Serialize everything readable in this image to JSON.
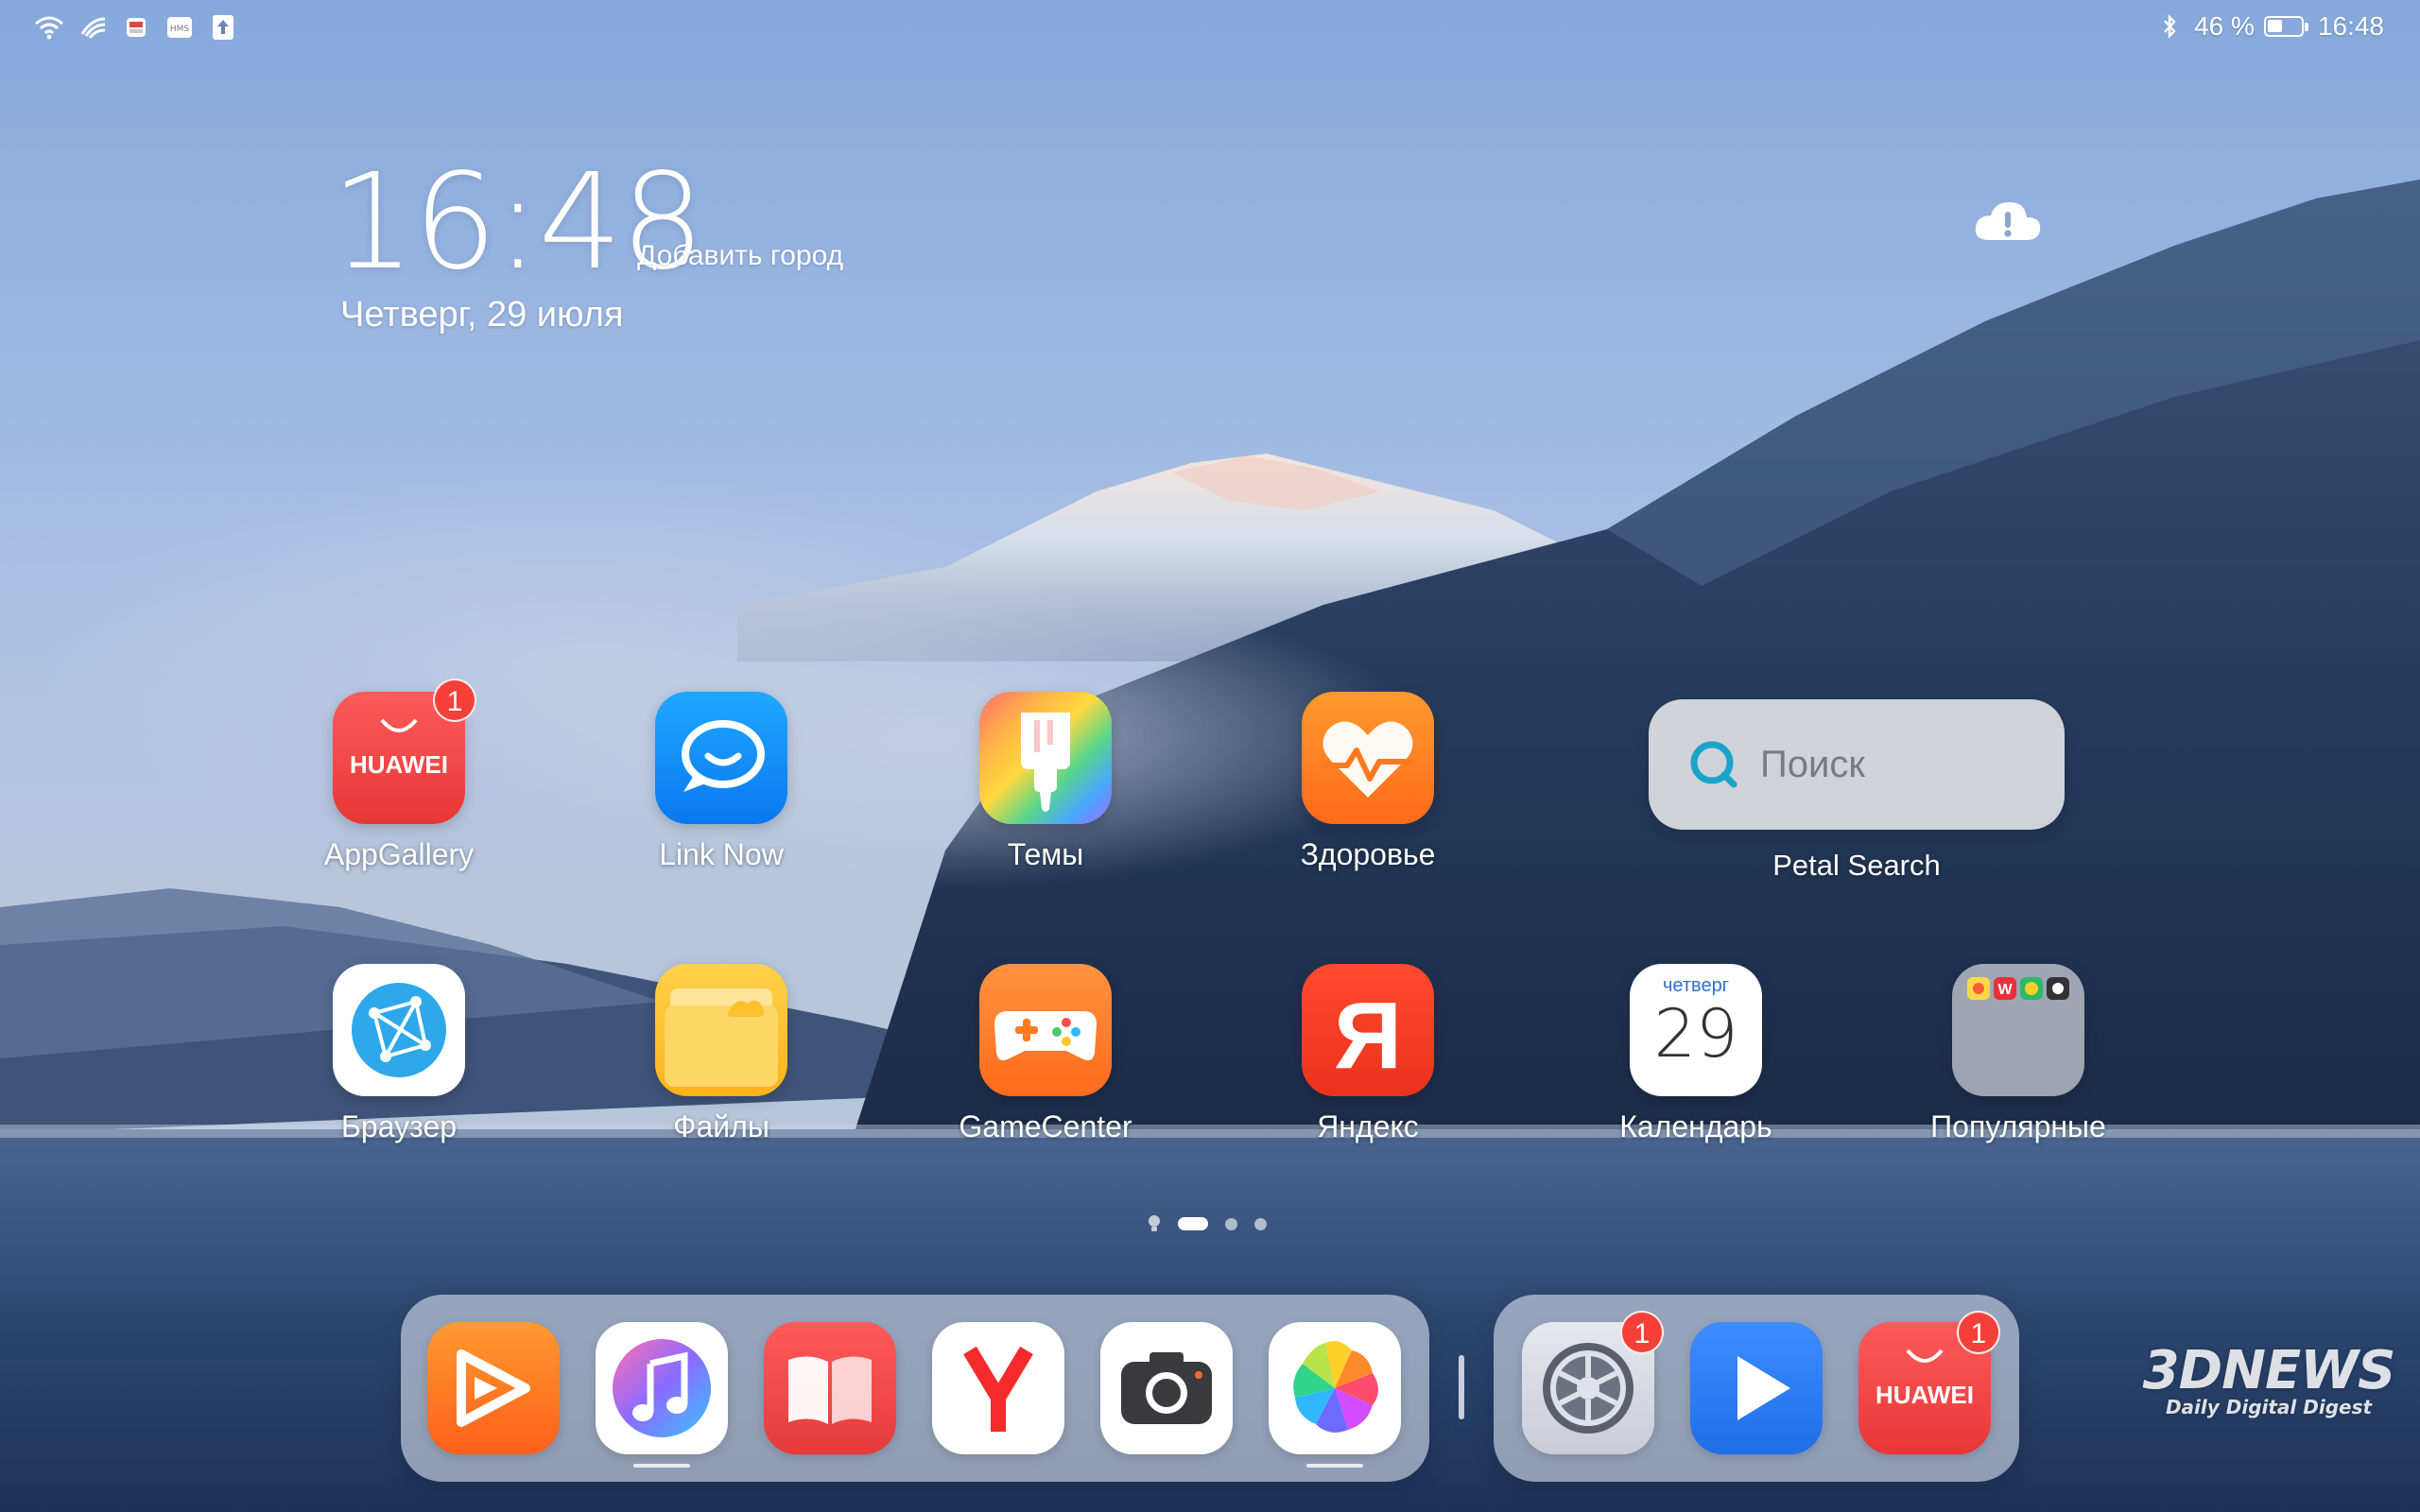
{
  "status_bar": {
    "left_icons": [
      "wifi-icon",
      "signal-icon",
      "notification-app-icon",
      "hms-icon",
      "upload-icon"
    ],
    "hms_label": "HMS",
    "bluetooth_icon": "bluetooth-icon",
    "battery_percent": "46 %",
    "battery_level": 0.46,
    "time": "16:48"
  },
  "clock_widget": {
    "time": "16:48",
    "add_city": "Добавить город",
    "date": "Четверг, 29 июля",
    "weather_icon": "cloud-alert-icon"
  },
  "apps": {
    "row1": [
      {
        "name": "appgallery",
        "label": "AppGallery",
        "badge": "1",
        "logo_text": "HUAWEI"
      },
      {
        "name": "link-now",
        "label": "Link Now"
      },
      {
        "name": "themes",
        "label": "Темы"
      },
      {
        "name": "health",
        "label": "Здоровье"
      }
    ],
    "row2": [
      {
        "name": "browser",
        "label": "Браузер"
      },
      {
        "name": "files",
        "label": "Файлы"
      },
      {
        "name": "gamecenter",
        "label": "GameCenter"
      },
      {
        "name": "yandex",
        "label": "Яндекс",
        "logo_text": "Я"
      },
      {
        "name": "calendar",
        "label": "Календарь",
        "weekday": "четверг",
        "day": "29"
      },
      {
        "name": "popular-folder",
        "label": "Популярные"
      }
    ]
  },
  "search_widget": {
    "placeholder": "Поиск",
    "caption": "Petal Search"
  },
  "page_indicator": {
    "pages": 4,
    "current": 2
  },
  "dock": {
    "left": [
      {
        "name": "huawei-video",
        "icon": "play-ribbon-icon"
      },
      {
        "name": "music",
        "icon": "music-note-icon",
        "running": true
      },
      {
        "name": "books",
        "icon": "book-icon"
      },
      {
        "name": "yandex-browser",
        "icon": "yandex-y-icon"
      },
      {
        "name": "camera",
        "icon": "camera-icon"
      },
      {
        "name": "gallery",
        "icon": "pinwheel-icon",
        "running": true
      }
    ],
    "right": [
      {
        "name": "settings",
        "icon": "gear-icon",
        "badge": "1"
      },
      {
        "name": "video-player",
        "icon": "play-icon"
      },
      {
        "name": "appgallery",
        "icon": "huawei-bag-icon",
        "badge": "1",
        "logo_text": "HUAWEI"
      }
    ]
  },
  "watermark": {
    "logo": "3DNEWS",
    "tagline": "Daily Digital Digest"
  },
  "colors": {
    "sky_top": "#8fb0e0",
    "sky_mid": "#a9c0e4",
    "badge_red": "#f5403a",
    "forest": "#243a5a",
    "lake": "#2f4a72"
  }
}
